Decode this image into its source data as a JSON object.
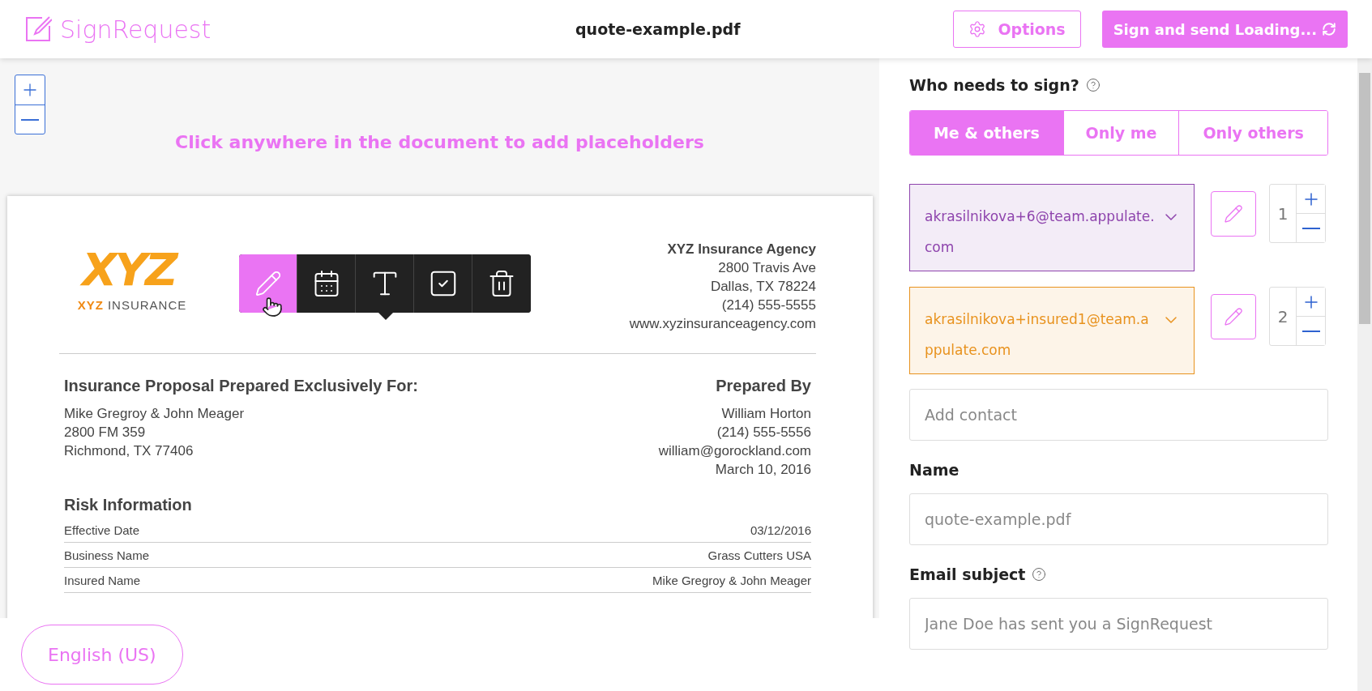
{
  "header": {
    "logo": "SignRequest",
    "file_name": "quote-example.pdf",
    "options_button": "Options",
    "send_button": "Sign and send Loading..."
  },
  "hint": "Click anywhere in the document to add placeholders",
  "toolbar": {
    "tools": [
      {
        "kind": "signature",
        "selected": true
      },
      {
        "kind": "date",
        "selected": false
      },
      {
        "kind": "text",
        "selected": false
      },
      {
        "kind": "checkbox",
        "selected": false
      },
      {
        "kind": "delete",
        "selected": false
      }
    ]
  },
  "document": {
    "logo_mark": "XYZ",
    "logo_caption": [
      "XYZ",
      "INSURANCE"
    ],
    "agency_name": "XYZ Insurance Agency",
    "agency_lines": [
      "2800 Travis Ave",
      "Dallas, TX 78224",
      "(214) 555-5555",
      "www.xyzinsuranceagency.com"
    ],
    "proposal_heading": "Insurance Proposal Prepared Exclusively For:",
    "client_lines": [
      "Mike Gregroy & John Meager",
      "2800 FM 359",
      "Richmond, TX 77406"
    ],
    "prepared_heading": "Prepared By",
    "prepared_lines": [
      "William Horton",
      "(214) 555-5556",
      "william@gorockland.com",
      "March 10, 2016"
    ],
    "risk_heading": "Risk Information",
    "risk_rows": [
      {
        "label": "Effective Date",
        "value": "03/12/2016"
      },
      {
        "label": "Business Name",
        "value": "Grass Cutters USA"
      },
      {
        "label": "Insured Name",
        "value": "Mike Gregroy & John Meager"
      }
    ]
  },
  "language_button": "English (US)",
  "panel": {
    "who_heading": "Who needs to sign?",
    "sign_modes": [
      {
        "label": "Me & others",
        "selected": true
      },
      {
        "label": "Only me",
        "selected": false
      },
      {
        "label": "Only others",
        "selected": false
      }
    ],
    "signers": [
      {
        "email": "akrasilnikova+6@team.appulate.com",
        "color": "#8e44ad",
        "order": "1"
      },
      {
        "email": "akrasilnikova+insured1@team.appulate.com",
        "color": "#e8921e",
        "order": "2"
      }
    ],
    "add_contact_placeholder": "Add contact",
    "name_label": "Name",
    "name_placeholder": "quote-example.pdf",
    "email_subject_label": "Email subject",
    "email_subject_placeholder": "Jane Doe has sent you a SignRequest"
  }
}
